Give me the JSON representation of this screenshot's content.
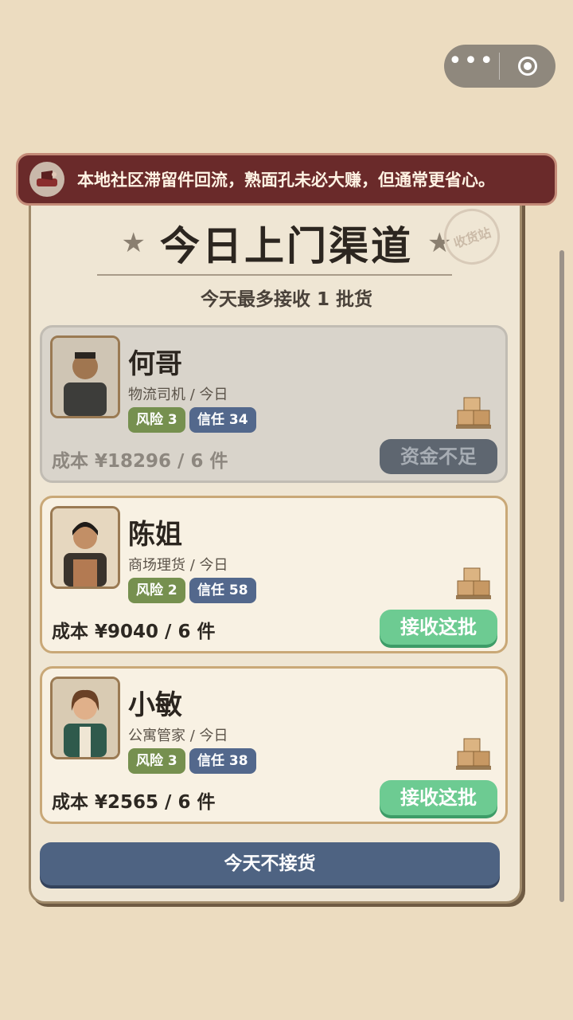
{
  "banner": {
    "text": "本地社区滞留件回流，熟面孔未必大赚，但通常更省心。"
  },
  "header": {
    "title": "今日上门渠道",
    "stamp": "收货站",
    "subtitle": "今天最多接收 1 批货"
  },
  "cards": [
    {
      "name": "何哥",
      "role": "物流司机 / 今日",
      "risk": "风险 3",
      "trust": "信任 34",
      "cost": "成本 ¥18296 / 6 件",
      "action": "资金不足",
      "enabled": false
    },
    {
      "name": "陈姐",
      "role": "商场理货 / 今日",
      "risk": "风险 2",
      "trust": "信任 58",
      "cost": "成本 ¥9040 / 6 件",
      "action": "接收这批",
      "enabled": true
    },
    {
      "name": "小敏",
      "role": "公寓管家 / 今日",
      "risk": "风险 3",
      "trust": "信任 38",
      "cost": "成本 ¥2565 / 6 件",
      "action": "接收这批",
      "enabled": true
    }
  ],
  "footer": {
    "skip_label": "今天不接货"
  },
  "colors": {
    "accept": "#6dcb92",
    "disabled": "#5e6670",
    "risk_tag": "#76904f",
    "trust_tag": "#53688c",
    "banner_bg": "#6a2a2a"
  }
}
